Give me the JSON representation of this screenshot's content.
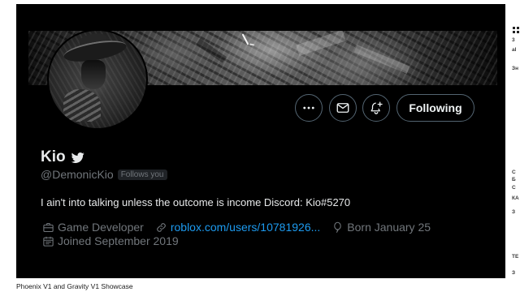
{
  "page": {
    "caption": "Phoenix V1 and Gravity V1 Showcase"
  },
  "colors": {
    "frame": "#000000",
    "text": "#e7e9ea",
    "muted": "#71767b",
    "link": "#1d9bf0",
    "button_border": "#536471",
    "badge": "#202327"
  },
  "profile": {
    "name": "Kio",
    "name_icon": "bird-icon",
    "handle": "@DemonicKio",
    "follows_you_badge": "Follows you",
    "bio": "I ain't into talking unless the outcome is income Discord: Kio#5270",
    "actions": [
      {
        "icon": "more-icon"
      },
      {
        "icon": "mail-icon"
      },
      {
        "icon": "bell-plus-icon"
      }
    ],
    "follow_button_label": "Following",
    "meta": [
      {
        "icon": "briefcase-icon",
        "text": "Game Developer"
      },
      {
        "icon": "link-icon",
        "text": "roblox.com/users/10781926..."
      },
      {
        "icon": "balloon-icon",
        "text": "Born January 25"
      },
      {
        "icon": "calendar-icon",
        "text": "Joined September 2019"
      }
    ]
  },
  "sidebar": {
    "icon": "grid-icon",
    "fragments": [
      "3",
      "al",
      "Зн",
      "С",
      "Б",
      "С",
      "КА",
      "З",
      "ТЕ",
      "З"
    ]
  }
}
